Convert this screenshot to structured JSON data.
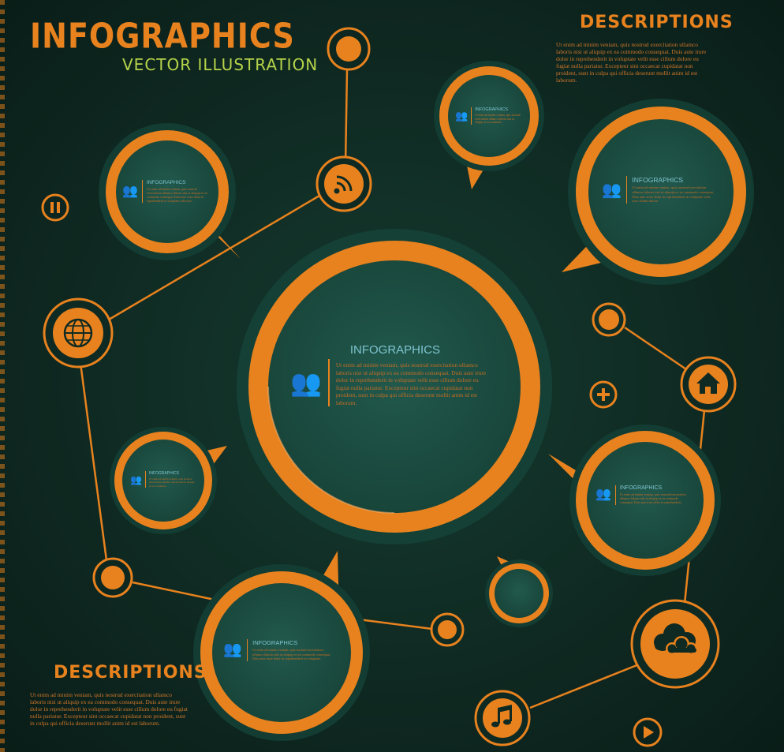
{
  "header": {
    "title": "INFOGRAPHICS",
    "subtitle": "VECTOR ILLUSTRATION"
  },
  "descriptions": {
    "top": {
      "title": "DESCRIPTIONS",
      "body": "Ut enim ad minim veniam, quis nostrud exercitation ullamco laboris nisi ut aliquip ex ea commodo consequat. Duis aute irure dolor in reprehenderit in voluptate velit esse cillum dolore eu fugiat nulla pariatur. Excepteur sint occaecat cupidatat non proident, sunt in culpa qui officia deserunt mollit anim id est laborum."
    },
    "bottom": {
      "title": "DESCRIPTIONS",
      "body": "Ut enim ad minim veniam, quis nostrud exercitation ullamco laboris nisi ut aliquip ex ea commodo consequat. Duis aute irure dolor in reprehenderit in voluptate velit esse cillum dolore eu fugiat nulla pariatur. Excepteur sint occaecat cupidatat non proident, sunt in culpa qui officia deserunt mollit anim id est laborum."
    }
  },
  "bubbles": {
    "center": {
      "title": "INFOGRAPHICS",
      "body": "Ut enim ad minim veniam, quis nostrud exercitation ullamco laboris nisi ut aliquip ex ea commodo consequat. Duis aute irure dolor in reprehenderit in voluptate velit esse cillum dolore eu fugiat nulla pariatur. Excepteur sint occaecat cupidatat non proident, sunt in culpa qui officia deserunt mollit anim id est laborum."
    },
    "top_left": {
      "title": "INFOGRAPHICS",
      "body": "Ut enim ad minim veniam, quis nostrud exercitation ullamco laboris nisi ut aliquip ex ea commodo consequat. Duis aute irure dolor in reprehenderit in voluptate velit esse."
    },
    "top_mid": {
      "title": "INFOGRAPHICS",
      "body": "Ut enim ad minim veniam, quis nostrud exercitation ullamco laboris nisi ut aliquip ex ea commodo."
    },
    "top_right": {
      "title": "INFOGRAPHICS",
      "body": "Ut enim ad minim veniam, quis nostrud exercitation ullamco laboris nisi ut aliquip ex ea commodo consequat. Duis aute irure dolor in reprehenderit in voluptate velit esse cillum dolore."
    },
    "mid_left": {
      "title": "INFOGRAPHICS",
      "body": "Ut enim ad minim veniam, quis nostrud exercitation ullamco laboris nisi ut aliquip ex ea commodo."
    },
    "mid_right": {
      "title": "INFOGRAPHICS",
      "body": "Ut enim ad minim veniam, quis nostrud exercitation ullamco laboris nisi ut aliquip ex ea commodo consequat. Duis aute irure dolor in reprehenderit."
    },
    "bottom_center": {
      "title": "INFOGRAPHICS",
      "body": "Ut enim ad minim veniam, quis nostrud exercitation ullamco laboris nisi ut aliquip ex ea commodo consequat. Duis aute irure dolor in reprehenderit in voluptate."
    }
  },
  "icons": [
    "wifi-icon",
    "globe-icon",
    "pause-icon",
    "home-icon",
    "plus-icon",
    "cloud-icon",
    "music-icon",
    "play-icon",
    "people-icon"
  ],
  "colors": {
    "accent": "#e8821e",
    "bubble_fill": "#1d4f45",
    "bubble_ring": "#133c33",
    "background": "#0f2a22",
    "title_green": "#b6d34a",
    "caption_blue": "#7ec4cf"
  }
}
